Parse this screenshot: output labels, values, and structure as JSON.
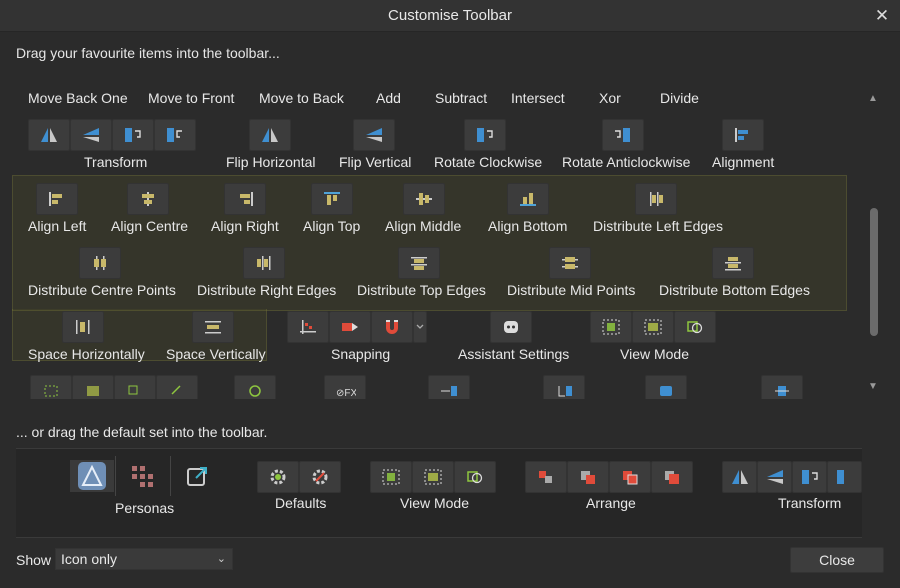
{
  "window": {
    "title": "Customise Toolbar"
  },
  "drag_hint": "Drag your favourite items into the toolbar...",
  "top_labels": [
    "Move Back One",
    "Move to Front",
    "Move to Back",
    "Add",
    "Subtract",
    "Intersect",
    "Xor",
    "Divide"
  ],
  "row2_labels": [
    "Transform",
    "Flip Horizontal",
    "Flip Vertical",
    "Rotate Clockwise",
    "Rotate Anticlockwise",
    "Alignment"
  ],
  "row3_labels": [
    "Align Left",
    "Align Centre",
    "Align Right",
    "Align Top",
    "Align Middle",
    "Align Bottom",
    "Distribute Left Edges"
  ],
  "row4_labels": [
    "Distribute Centre Points",
    "Distribute Right Edges",
    "Distribute Top Edges",
    "Distribute Mid Points",
    "Distribute Bottom Edges"
  ],
  "row5_labels": [
    "Space Horizontally",
    "Space Vertically",
    "Snapping",
    "Assistant Settings",
    "View Mode"
  ],
  "default_hint": "... or drag the default set into the toolbar.",
  "default_labels": [
    "Personas",
    "Defaults",
    "View Mode",
    "Arrange",
    "Transform"
  ],
  "show": {
    "label": "Show",
    "value": "Icon only"
  },
  "close_label": "Close",
  "colors": {
    "accent_blue": "#3f8fd1",
    "accent_red": "#e04b3a",
    "accent_green": "#8ec63f",
    "highlight": "#4d4f25"
  }
}
